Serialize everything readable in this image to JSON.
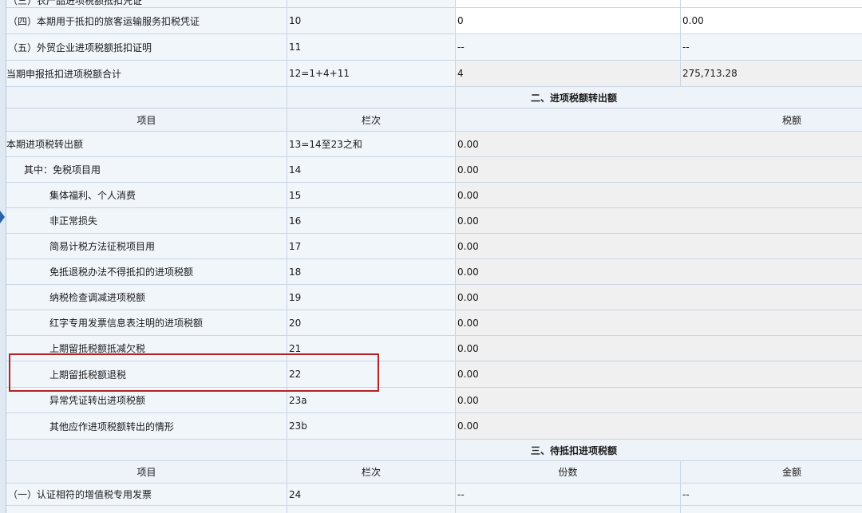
{
  "partial_top_row": {
    "item": "（三）农产品进项税额抵扣凭证"
  },
  "section1_rows": [
    {
      "item": "（四）本期用于抵扣的旅客运输服务扣税凭证",
      "col": "10",
      "v1": "0",
      "v2": "0.00"
    },
    {
      "item": "（五）外贸企业进项税额抵扣证明",
      "col": "11",
      "v1": "--",
      "v2": "--"
    },
    {
      "item": "当期申报抵扣进项税额合计",
      "col": "12=1+4+11",
      "v1": "4",
      "v2": "275,713.28"
    }
  ],
  "section2": {
    "title": "二、进项税额转出额",
    "headers": {
      "item": "项目",
      "col": "栏次",
      "amount": "税额"
    },
    "rows": [
      {
        "item": "本期进项税转出额",
        "col": "13=14至23之和",
        "value": "0.00"
      },
      {
        "item": "其中：免税项目用",
        "col": "14",
        "value": "0.00"
      },
      {
        "item": "集体福利、个人消费",
        "col": "15",
        "value": "0.00"
      },
      {
        "item": "非正常损失",
        "col": "16",
        "value": "0.00"
      },
      {
        "item": "简易计税方法征税项目用",
        "col": "17",
        "value": "0.00"
      },
      {
        "item": "免抵退税办法不得抵扣的进项税额",
        "col": "18",
        "value": "0.00"
      },
      {
        "item": "纳税检查调减进项税额",
        "col": "19",
        "value": "0.00"
      },
      {
        "item": "红字专用发票信息表注明的进项税额",
        "col": "20",
        "value": "0.00"
      },
      {
        "item": "上期留抵税额抵减欠税",
        "col": "21",
        "value": "0.00"
      },
      {
        "item": "上期留抵税额退税",
        "col": "22",
        "value": "0.00"
      },
      {
        "item": "异常凭证转出进项税额",
        "col": "23a",
        "value": "0.00"
      },
      {
        "item": "其他应作进项税额转出的情形",
        "col": "23b",
        "value": "0.00"
      }
    ]
  },
  "section3": {
    "title": "三、待抵扣进项税额",
    "headers": {
      "item": "项目",
      "col": "栏次",
      "count": "份数",
      "amount": "金额"
    },
    "rows": [
      {
        "item": "（一）认证相符的增值税专用发票",
        "col": "24",
        "v1": "--",
        "v2": "--"
      }
    ]
  },
  "colors": {
    "highlight": "#b22424",
    "grid": "#c9d6e4",
    "row_bg": "#f1f6fb"
  }
}
